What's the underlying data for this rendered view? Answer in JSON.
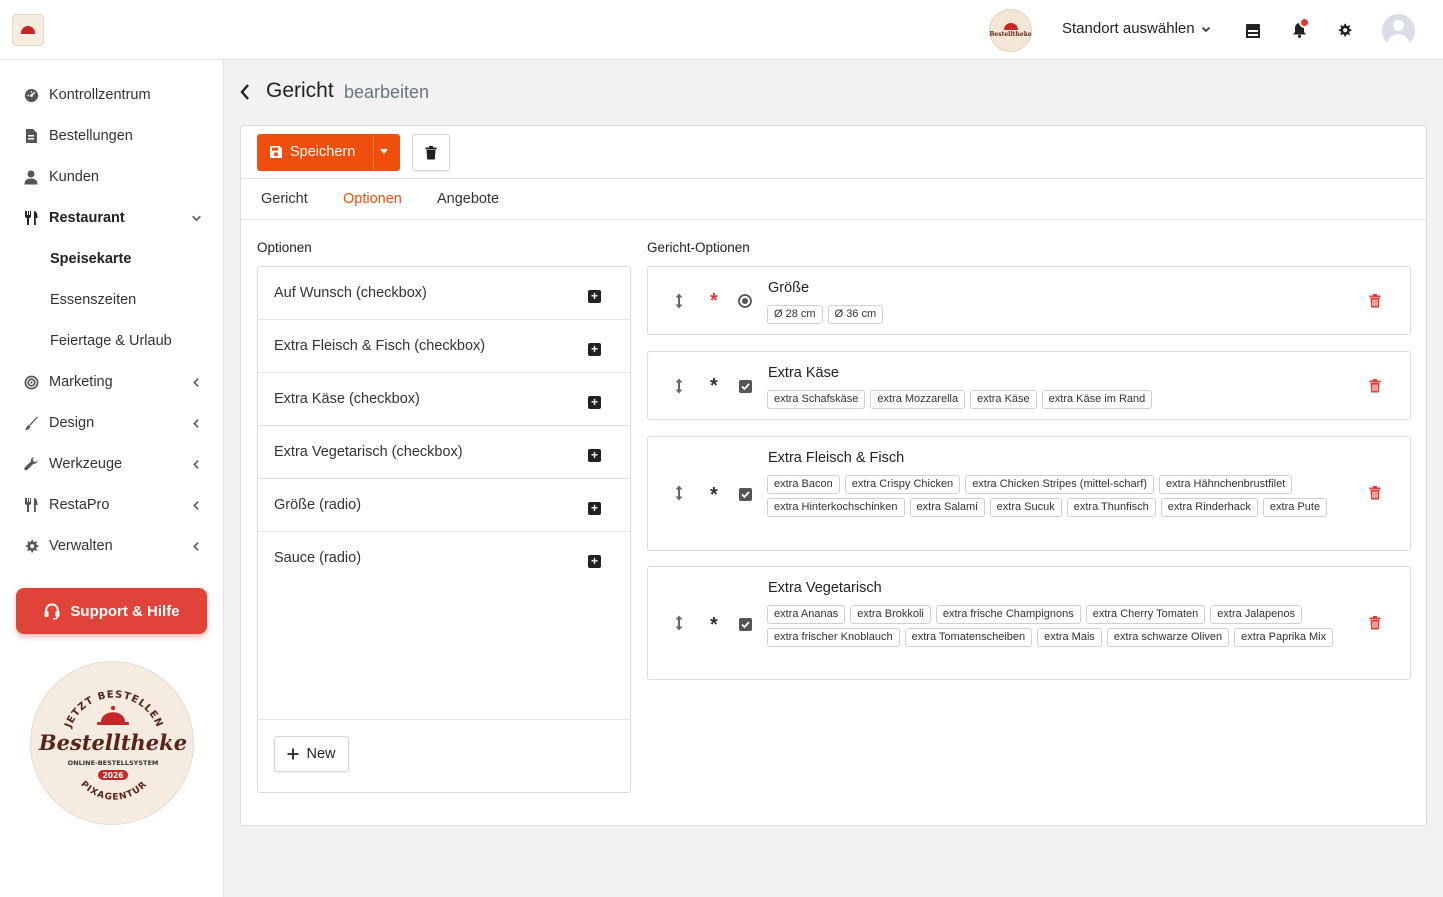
{
  "header": {
    "logo_name": "Bestelltheke",
    "location_label": "Standort auswählen",
    "icons": [
      "store-icon",
      "bell-icon",
      "gear-icon",
      "user-avatar"
    ]
  },
  "sidebar": {
    "items": [
      {
        "label": "Kontrollzentrum",
        "icon": "dashboard-icon"
      },
      {
        "label": "Bestellungen",
        "icon": "orders-icon"
      },
      {
        "label": "Kunden",
        "icon": "user-icon"
      },
      {
        "label": "Restaurant",
        "icon": "utensils-icon",
        "expanded": true
      },
      {
        "label": "Speisekarte",
        "sub": true,
        "active": true
      },
      {
        "label": "Essenszeiten",
        "sub": true
      },
      {
        "label": "Feiertage & Urlaub",
        "sub": true
      },
      {
        "label": "Marketing",
        "icon": "target-icon"
      },
      {
        "label": "Design",
        "icon": "brush-icon"
      },
      {
        "label": "Werkzeuge",
        "icon": "wrench-icon"
      },
      {
        "label": "RestaPro",
        "icon": "utensils-icon"
      },
      {
        "label": "Verwalten",
        "icon": "gear-icon"
      }
    ],
    "support_label": "Support & Hilfe",
    "badge": {
      "top_text": "JETZT BESTELLEN",
      "brand": "Bestelltheke",
      "subtitle": "ONLINE-BESTELLSYSTEM",
      "year": "2026",
      "bottom_text": "PIXAGENTUR"
    }
  },
  "page": {
    "title": "Gericht",
    "subtitle": "bearbeiten"
  },
  "toolbar": {
    "save_label": "Speichern"
  },
  "tabs": [
    {
      "label": "Gericht",
      "active": false
    },
    {
      "label": "Optionen",
      "active": true
    },
    {
      "label": "Angebote",
      "active": false
    }
  ],
  "options_panel": {
    "heading": "Optionen",
    "items": [
      "Auf Wunsch (checkbox)",
      "Extra Fleisch & Fisch (checkbox)",
      "Extra Käse (checkbox)",
      "Extra Vegetarisch (checkbox)",
      "Größe (radio)",
      "Sauce (radio)"
    ],
    "new_label": "New"
  },
  "dish_options": {
    "heading": "Gericht-Optionen",
    "groups": [
      {
        "title": "Größe",
        "required": true,
        "type": "radio",
        "tags": [
          "Ø 28 cm",
          "Ø 36 cm"
        ]
      },
      {
        "title": "Extra Käse",
        "required": false,
        "type": "checkbox",
        "tags": [
          "extra Schafskäse",
          "extra Mozzarella",
          "extra Käse",
          "extra Käse im Rand"
        ]
      },
      {
        "title": "Extra Fleisch & Fisch",
        "required": false,
        "type": "checkbox",
        "tags": [
          "extra Bacon",
          "extra Crispy Chicken",
          "extra Chicken Stripes (mittel-scharf)",
          "extra Hähnchenbrustfilet",
          "extra Hinterkochschinken",
          "extra Salami",
          "extra Sucuk",
          "extra Thunfisch",
          "extra Rinderhack",
          "extra Pute"
        ]
      },
      {
        "title": "Extra Vegetarisch",
        "required": false,
        "type": "checkbox",
        "tags": [
          "extra Ananas",
          "extra Brokkoli",
          "extra frische Champignons",
          "extra Cherry Tomaten",
          "extra Jalapenos",
          "extra frischer Knoblauch",
          "extra Tomatenscheiben",
          "extra Mais",
          "extra schwarze Oliven",
          "extra Paprika Mix"
        ]
      }
    ]
  },
  "colors": {
    "accent": "#f04e0c",
    "support": "#e04438",
    "required_active": "#e53935",
    "trash": "#e53935"
  }
}
